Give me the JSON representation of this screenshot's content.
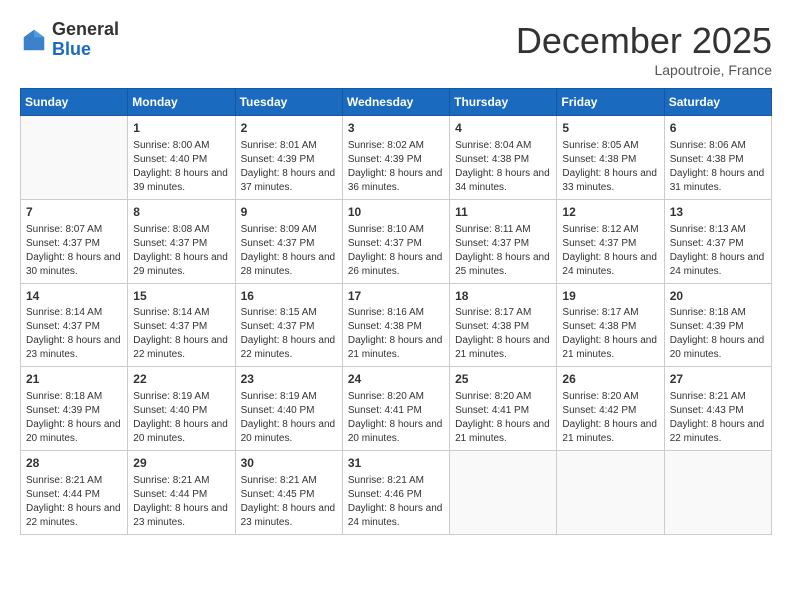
{
  "logo": {
    "general": "General",
    "blue": "Blue"
  },
  "header": {
    "month": "December 2025",
    "location": "Lapoutroie, France"
  },
  "weekdays": [
    "Sunday",
    "Monday",
    "Tuesday",
    "Wednesday",
    "Thursday",
    "Friday",
    "Saturday"
  ],
  "weeks": [
    [
      {
        "day": null
      },
      {
        "day": 1,
        "sunrise": "8:00 AM",
        "sunset": "4:40 PM",
        "daylight": "8 hours and 39 minutes."
      },
      {
        "day": 2,
        "sunrise": "8:01 AM",
        "sunset": "4:39 PM",
        "daylight": "8 hours and 37 minutes."
      },
      {
        "day": 3,
        "sunrise": "8:02 AM",
        "sunset": "4:39 PM",
        "daylight": "8 hours and 36 minutes."
      },
      {
        "day": 4,
        "sunrise": "8:04 AM",
        "sunset": "4:38 PM",
        "daylight": "8 hours and 34 minutes."
      },
      {
        "day": 5,
        "sunrise": "8:05 AM",
        "sunset": "4:38 PM",
        "daylight": "8 hours and 33 minutes."
      },
      {
        "day": 6,
        "sunrise": "8:06 AM",
        "sunset": "4:38 PM",
        "daylight": "8 hours and 31 minutes."
      }
    ],
    [
      {
        "day": 7,
        "sunrise": "8:07 AM",
        "sunset": "4:37 PM",
        "daylight": "8 hours and 30 minutes."
      },
      {
        "day": 8,
        "sunrise": "8:08 AM",
        "sunset": "4:37 PM",
        "daylight": "8 hours and 29 minutes."
      },
      {
        "day": 9,
        "sunrise": "8:09 AM",
        "sunset": "4:37 PM",
        "daylight": "8 hours and 28 minutes."
      },
      {
        "day": 10,
        "sunrise": "8:10 AM",
        "sunset": "4:37 PM",
        "daylight": "8 hours and 26 minutes."
      },
      {
        "day": 11,
        "sunrise": "8:11 AM",
        "sunset": "4:37 PM",
        "daylight": "8 hours and 25 minutes."
      },
      {
        "day": 12,
        "sunrise": "8:12 AM",
        "sunset": "4:37 PM",
        "daylight": "8 hours and 24 minutes."
      },
      {
        "day": 13,
        "sunrise": "8:13 AM",
        "sunset": "4:37 PM",
        "daylight": "8 hours and 24 minutes."
      }
    ],
    [
      {
        "day": 14,
        "sunrise": "8:14 AM",
        "sunset": "4:37 PM",
        "daylight": "8 hours and 23 minutes."
      },
      {
        "day": 15,
        "sunrise": "8:14 AM",
        "sunset": "4:37 PM",
        "daylight": "8 hours and 22 minutes."
      },
      {
        "day": 16,
        "sunrise": "8:15 AM",
        "sunset": "4:37 PM",
        "daylight": "8 hours and 22 minutes."
      },
      {
        "day": 17,
        "sunrise": "8:16 AM",
        "sunset": "4:38 PM",
        "daylight": "8 hours and 21 minutes."
      },
      {
        "day": 18,
        "sunrise": "8:17 AM",
        "sunset": "4:38 PM",
        "daylight": "8 hours and 21 minutes."
      },
      {
        "day": 19,
        "sunrise": "8:17 AM",
        "sunset": "4:38 PM",
        "daylight": "8 hours and 21 minutes."
      },
      {
        "day": 20,
        "sunrise": "8:18 AM",
        "sunset": "4:39 PM",
        "daylight": "8 hours and 20 minutes."
      }
    ],
    [
      {
        "day": 21,
        "sunrise": "8:18 AM",
        "sunset": "4:39 PM",
        "daylight": "8 hours and 20 minutes."
      },
      {
        "day": 22,
        "sunrise": "8:19 AM",
        "sunset": "4:40 PM",
        "daylight": "8 hours and 20 minutes."
      },
      {
        "day": 23,
        "sunrise": "8:19 AM",
        "sunset": "4:40 PM",
        "daylight": "8 hours and 20 minutes."
      },
      {
        "day": 24,
        "sunrise": "8:20 AM",
        "sunset": "4:41 PM",
        "daylight": "8 hours and 20 minutes."
      },
      {
        "day": 25,
        "sunrise": "8:20 AM",
        "sunset": "4:41 PM",
        "daylight": "8 hours and 21 minutes."
      },
      {
        "day": 26,
        "sunrise": "8:20 AM",
        "sunset": "4:42 PM",
        "daylight": "8 hours and 21 minutes."
      },
      {
        "day": 27,
        "sunrise": "8:21 AM",
        "sunset": "4:43 PM",
        "daylight": "8 hours and 22 minutes."
      }
    ],
    [
      {
        "day": 28,
        "sunrise": "8:21 AM",
        "sunset": "4:44 PM",
        "daylight": "8 hours and 22 minutes."
      },
      {
        "day": 29,
        "sunrise": "8:21 AM",
        "sunset": "4:44 PM",
        "daylight": "8 hours and 23 minutes."
      },
      {
        "day": 30,
        "sunrise": "8:21 AM",
        "sunset": "4:45 PM",
        "daylight": "8 hours and 23 minutes."
      },
      {
        "day": 31,
        "sunrise": "8:21 AM",
        "sunset": "4:46 PM",
        "daylight": "8 hours and 24 minutes."
      },
      {
        "day": null
      },
      {
        "day": null
      },
      {
        "day": null
      }
    ]
  ]
}
